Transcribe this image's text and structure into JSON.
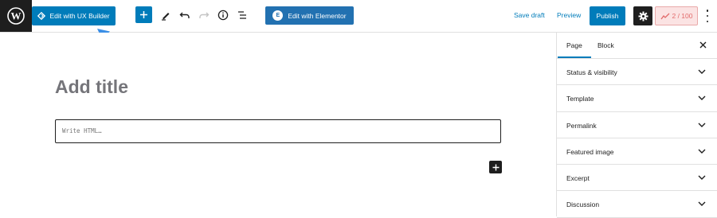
{
  "toolbar": {
    "ux_builder_label": "Edit with UX Builder",
    "elementor_label": "Edit with Elementor",
    "elementor_logo_glyph": "E",
    "save_draft_label": "Save draft",
    "preview_label": "Preview",
    "publish_label": "Publish",
    "seo_score": "2 / 100",
    "icons": [
      "wordpress-logo-icon",
      "ux-builder-icon",
      "plus-icon",
      "pencil-icon",
      "undo-icon",
      "redo-icon",
      "info-icon",
      "list-view-icon",
      "gear-icon",
      "seo-chart-icon",
      "more-vertical-icon"
    ]
  },
  "editor": {
    "title_placeholder": "Add title",
    "html_placeholder": "Write HTML…"
  },
  "sidebar": {
    "tabs": [
      "Page",
      "Block"
    ],
    "active_tab": "Page",
    "panels": [
      "Status & visibility",
      "Template",
      "Permalink",
      "Featured image",
      "Excerpt",
      "Discussion"
    ]
  },
  "colors": {
    "accent": "#007cba",
    "dark": "#1e1e1e",
    "annotation_arrow": "#3b8fe6",
    "score_bg": "#fbe3e3",
    "score_text": "#e26b6b"
  }
}
